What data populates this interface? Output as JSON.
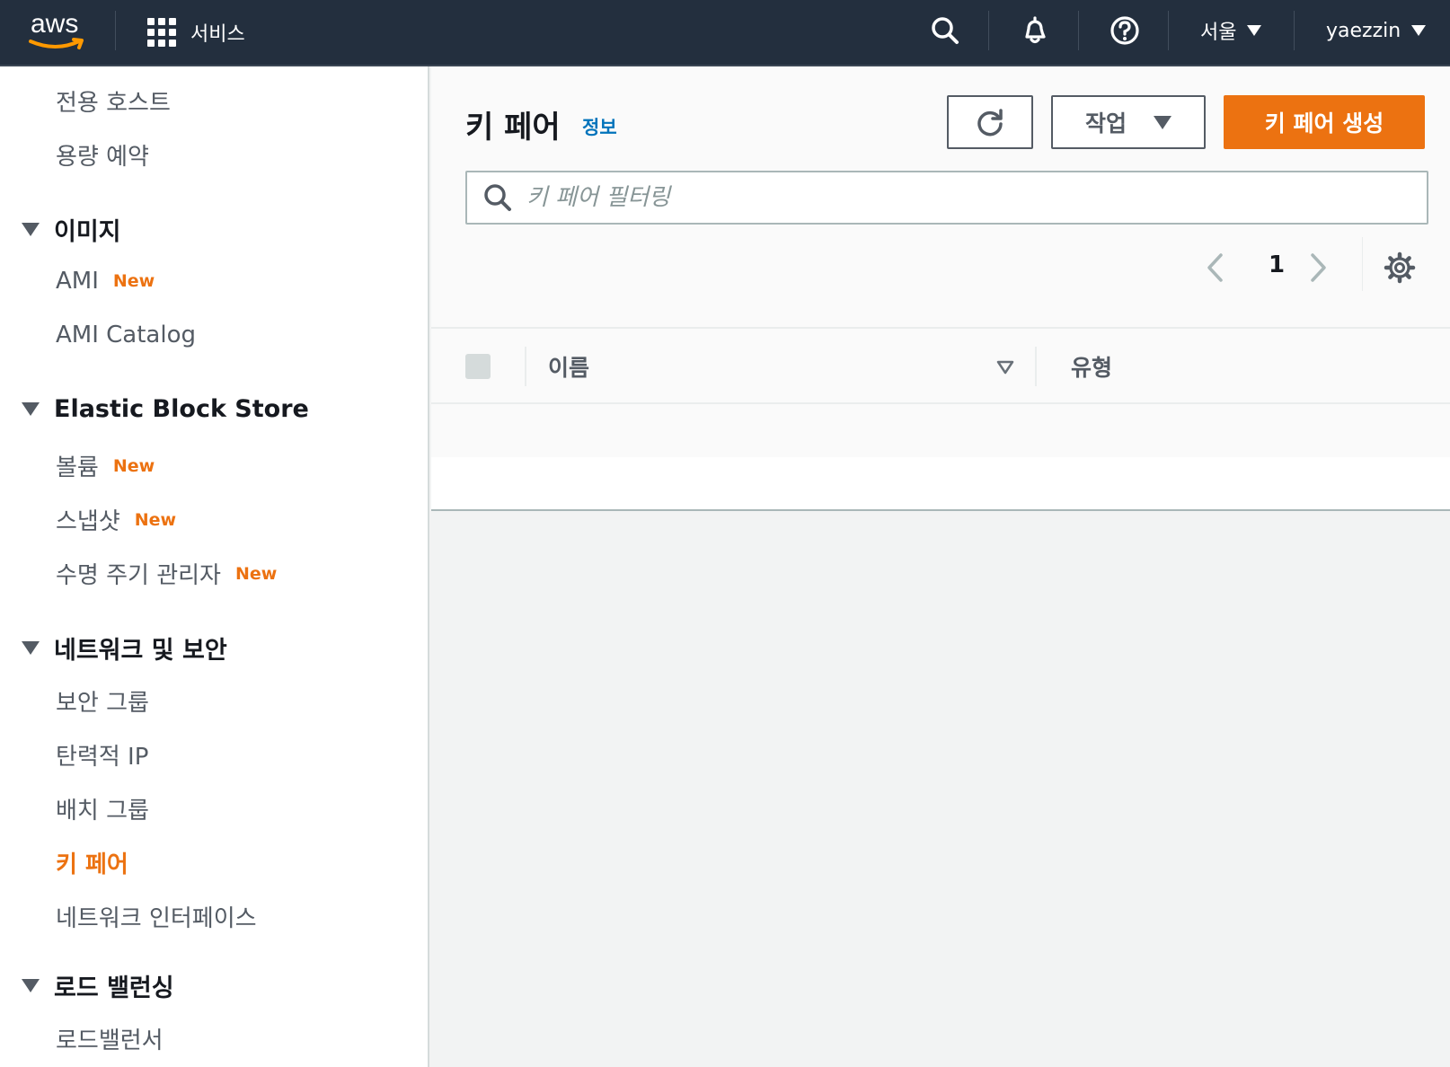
{
  "topnav": {
    "logo_text": "aws",
    "services_label": "서비스",
    "region_label": "서울",
    "user_label": "yaezzin",
    "icons": [
      "search-icon",
      "bell-icon",
      "help-icon"
    ]
  },
  "sidebar": {
    "items_top": [
      {
        "label": "전용 호스트"
      },
      {
        "label": "용량 예약"
      }
    ],
    "sections": [
      {
        "title": "이미지",
        "items": [
          {
            "label": "AMI",
            "badge": "New"
          },
          {
            "label": "AMI Catalog",
            "badge": ""
          }
        ]
      },
      {
        "title": "Elastic Block Store",
        "items": [
          {
            "label": "볼륨",
            "badge": "New"
          },
          {
            "label": "스냅샷",
            "badge": "New"
          },
          {
            "label": "수명 주기 관리자",
            "badge": "New"
          }
        ]
      },
      {
        "title": "네트워크 및 보안",
        "items": [
          {
            "label": "보안 그룹",
            "badge": ""
          },
          {
            "label": "탄력적 IP",
            "badge": ""
          },
          {
            "label": "배치 그룹",
            "badge": ""
          },
          {
            "label": "키 페어",
            "badge": "",
            "active": true
          },
          {
            "label": "네트워크 인터페이스",
            "badge": ""
          }
        ]
      },
      {
        "title": "로드 밸런싱",
        "items": [
          {
            "label": "로드밸런서",
            "badge": ""
          }
        ]
      }
    ]
  },
  "main": {
    "title": "키 페어",
    "info_link": "정보",
    "actions_label": "작업",
    "create_label": "키 페어 생성",
    "search_placeholder": "키 페어 필터링",
    "page_number": "1",
    "columns": [
      "이름",
      "유형"
    ]
  },
  "colors": {
    "nav_bg": "#232f3e",
    "accent": "#ec7211",
    "link": "#0073bb"
  }
}
